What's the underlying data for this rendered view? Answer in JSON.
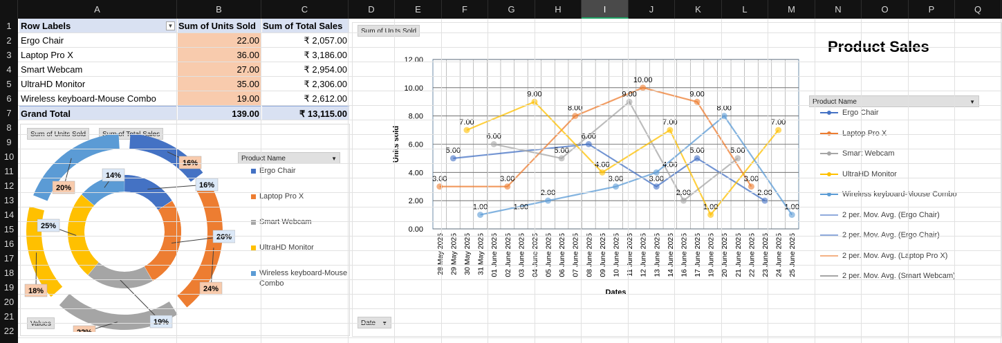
{
  "columns": [
    "A",
    "B",
    "C",
    "D",
    "E",
    "F",
    "G",
    "H",
    "I",
    "J",
    "K",
    "L",
    "M",
    "N",
    "O",
    "P",
    "Q"
  ],
  "selected_column": "I",
  "rows": [
    "1",
    "2",
    "3",
    "4",
    "5",
    "6",
    "7",
    "8",
    "9",
    "10",
    "11",
    "12",
    "13",
    "14",
    "15",
    "16",
    "17",
    "18",
    "19",
    "20",
    "21",
    "22"
  ],
  "pivot": {
    "headers": [
      "Row Labels",
      "Sum of Units Sold",
      "Sum of Total Sales"
    ],
    "rows": [
      {
        "label": "Ergo Chair",
        "units": "22.00",
        "sales": "₹ 2,057.00"
      },
      {
        "label": "Laptop Pro X",
        "units": "36.00",
        "sales": "₹ 3,186.00"
      },
      {
        "label": "Smart Webcam",
        "units": "27.00",
        "sales": "₹ 2,954.00"
      },
      {
        "label": "UltraHD Monitor",
        "units": "35.00",
        "sales": "₹ 2,306.00"
      },
      {
        "label": "Wireless keyboard-Mouse Combo",
        "units": "19.00",
        "sales": "₹ 2,612.00"
      }
    ],
    "total": {
      "label": "Grand Total",
      "units": "139.00",
      "sales": "₹ 13,115.00"
    }
  },
  "donut": {
    "field_buttons": [
      "Sum of Units Sold",
      "Sum of Total Sales"
    ],
    "values_button": "Values",
    "legend_title": "Product Name",
    "legend": [
      {
        "name": "Ergo Chair",
        "color": "#4472c4"
      },
      {
        "name": "Laptop Pro X",
        "color": "#ed7d31"
      },
      {
        "name": "Smart Webcam",
        "color": "#a5a5a5"
      },
      {
        "name": "UltraHD Monitor",
        "color": "#ffc000"
      },
      {
        "name": "Wireless keyboard-Mouse Combo",
        "color": "#5b9bd5"
      }
    ]
  },
  "line_chart": {
    "field_button": "Sum of Units Sold",
    "date_button": "Date",
    "title": "Product Sales",
    "legend_title": "Product Name",
    "legend": [
      {
        "name": "Ergo Chair",
        "color": "#4472c4",
        "marker": true
      },
      {
        "name": "Laptop Pro X",
        "color": "#ed7d31",
        "marker": true
      },
      {
        "name": "Smart Webcam",
        "color": "#a5a5a5",
        "marker": true
      },
      {
        "name": "UltraHD Monitor",
        "color": "#ffc000",
        "marker": true
      },
      {
        "name": "Wireless keyboard-Mouse Combo",
        "color": "#5b9bd5",
        "marker": true
      },
      {
        "name": "2 per. Mov. Avg. (Ergo Chair)",
        "color": "#8faadc",
        "marker": false
      },
      {
        "name": "2 per. Mov. Avg. (Ergo Chair)",
        "color": "#8faadc",
        "marker": false
      },
      {
        "name": "2 per. Mov. Avg. (Laptop Pro X)",
        "color": "#f4b183",
        "marker": false
      },
      {
        "name": "2 per. Mov. Avg. (Smart Webcam)",
        "color": "#a5a5a5",
        "marker": false
      }
    ]
  },
  "chart_data": [
    {
      "type": "pie",
      "variant": "doughnut",
      "rings": [
        {
          "name": "Sum of Units Sold",
          "categories": [
            "Ergo Chair",
            "Laptop Pro X",
            "Smart Webcam",
            "UltraHD Monitor",
            "Wireless keyboard-Mouse Combo"
          ],
          "values": [
            22,
            36,
            27,
            35,
            19
          ],
          "labels": [
            "16%",
            "26%",
            "19%",
            "25%",
            "14%"
          ]
        },
        {
          "name": "Sum of Total Sales",
          "categories": [
            "Ergo Chair",
            "Laptop Pro X",
            "Smart Webcam",
            "UltraHD Monitor",
            "Wireless keyboard-Mouse Combo"
          ],
          "values": [
            2057,
            3186,
            2954,
            2306,
            2612
          ],
          "labels": [
            "16%",
            "24%",
            "22%",
            "18%",
            "20%"
          ]
        }
      ]
    },
    {
      "type": "line",
      "title": "Product Sales",
      "xlabel": "Dates",
      "ylabel": "Units sold",
      "ylim": [
        0,
        12
      ],
      "yticks": [
        "0.00",
        "2.00",
        "4.00",
        "6.00",
        "8.00",
        "10.00",
        "12.00"
      ],
      "grid": true,
      "legend_position": "right",
      "x": [
        "28 May 2025",
        "29 May 2025",
        "30 May 2025",
        "31 May 2025",
        "01 June 2025",
        "02 June 2025",
        "03 June 2025",
        "04 June 2025",
        "05 June 2025",
        "06 June 2025",
        "07 June 2025",
        "08 June 2025",
        "09 June 2025",
        "10 June 2025",
        "11 June 2025",
        "12 June 2025",
        "13 June 2025",
        "14 June 2025",
        "16 June 2025",
        "17 June 2025",
        "19 June 2025",
        "20 June 2025",
        "21 June 2025",
        "22 June 2025",
        "23 June 2025",
        "24 June 2025",
        "25 June 2025"
      ],
      "series": [
        {
          "name": "Ergo Chair",
          "color": "#4472c4",
          "points": [
            [
              1,
              5
            ],
            [
              11,
              6
            ],
            [
              16,
              3
            ],
            [
              19,
              5
            ],
            [
              24,
              2
            ]
          ]
        },
        {
          "name": "Laptop Pro X",
          "color": "#ed7d31",
          "points": [
            [
              0,
              3
            ],
            [
              5,
              3
            ],
            [
              10,
              8
            ],
            [
              15,
              10
            ],
            [
              19,
              9
            ],
            [
              23,
              3
            ]
          ]
        },
        {
          "name": "Smart Webcam",
          "color": "#a5a5a5",
          "points": [
            [
              4,
              6
            ],
            [
              9,
              5
            ],
            [
              14,
              9
            ],
            [
              18,
              2
            ],
            [
              22,
              5
            ]
          ]
        },
        {
          "name": "UltraHD Monitor",
          "color": "#ffc000",
          "points": [
            [
              2,
              7
            ],
            [
              7,
              9
            ],
            [
              12,
              4
            ],
            [
              17,
              7
            ],
            [
              20,
              1
            ],
            [
              25,
              7
            ]
          ]
        },
        {
          "name": "Wireless keyboard-Mouse Combo",
          "color": "#5b9bd5",
          "points": [
            [
              3,
              1
            ],
            [
              8,
              2
            ],
            [
              13,
              3
            ],
            [
              16,
              4
            ],
            [
              21,
              8
            ],
            [
              26,
              1
            ]
          ]
        }
      ],
      "data_labels": [
        {
          "x": 0,
          "y": 3,
          "text": "3.00"
        },
        {
          "x": 1,
          "y": 5,
          "text": "5.00"
        },
        {
          "x": 2,
          "y": 7,
          "text": "7.00"
        },
        {
          "x": 3,
          "y": 1,
          "text": "1.00"
        },
        {
          "x": 4,
          "y": 6,
          "text": "6.00"
        },
        {
          "x": 5,
          "y": 3,
          "text": "3.00"
        },
        {
          "x": 6,
          "y": 1,
          "text": "1.00"
        },
        {
          "x": 7,
          "y": 9,
          "text": "9.00"
        },
        {
          "x": 8,
          "y": 2,
          "text": "2.00"
        },
        {
          "x": 9,
          "y": 5,
          "text": "5.00"
        },
        {
          "x": 10,
          "y": 8,
          "text": "8.00"
        },
        {
          "x": 11,
          "y": 6,
          "text": "6.00"
        },
        {
          "x": 12,
          "y": 4,
          "text": "4.00"
        },
        {
          "x": 13,
          "y": 3,
          "text": "3.00"
        },
        {
          "x": 14,
          "y": 9,
          "text": "9.00"
        },
        {
          "x": 15,
          "y": 10,
          "text": "10.00"
        },
        {
          "x": 16,
          "y": 3,
          "text": "3.00"
        },
        {
          "x": 17,
          "y": 7,
          "text": "7.00"
        },
        {
          "x": 17,
          "y": 4,
          "text": "4.00"
        },
        {
          "x": 18,
          "y": 2,
          "text": "2.00"
        },
        {
          "x": 19,
          "y": 9,
          "text": "9.00"
        },
        {
          "x": 19,
          "y": 5,
          "text": "5.00"
        },
        {
          "x": 20,
          "y": 1,
          "text": "1.00"
        },
        {
          "x": 21,
          "y": 8,
          "text": "8.00"
        },
        {
          "x": 22,
          "y": 5,
          "text": "5.00"
        },
        {
          "x": 23,
          "y": 3,
          "text": "3.00"
        },
        {
          "x": 24,
          "y": 2,
          "text": "2.00"
        },
        {
          "x": 25,
          "y": 7,
          "text": "7.00"
        },
        {
          "x": 26,
          "y": 1,
          "text": "1.00"
        }
      ]
    }
  ]
}
